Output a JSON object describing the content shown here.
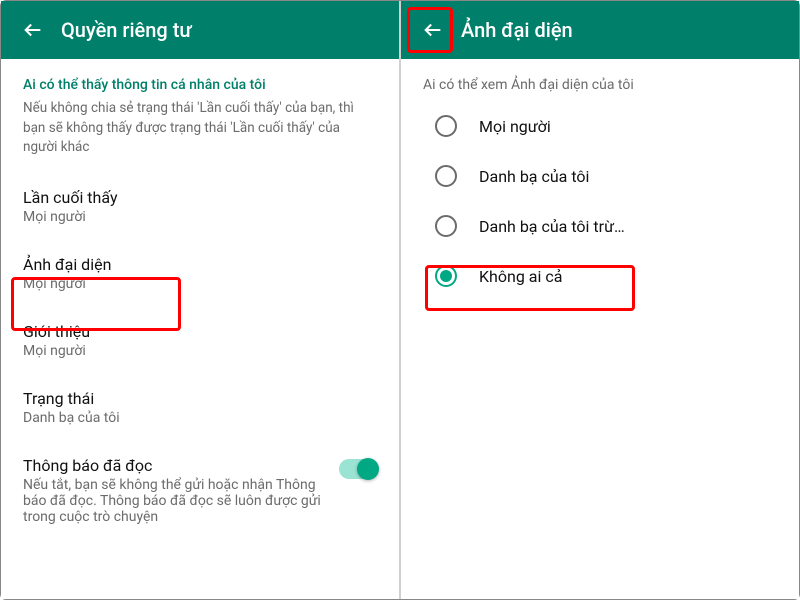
{
  "left": {
    "title": "Quyền riêng tư",
    "section_label": "Ai có thể thấy thông tin cá nhân của tôi",
    "section_note": "Nếu không chia sẻ trạng thái 'Lần cuối thấy' của bạn, thì bạn sẽ không thấy được trạng thái 'Lần cuối thấy' của người khác",
    "items": [
      {
        "title": "Lần cuối thấy",
        "sub": "Mọi người"
      },
      {
        "title": "Ảnh đại diện",
        "sub": "Mọi người"
      },
      {
        "title": "Giới thiệu",
        "sub": "Mọi người"
      },
      {
        "title": "Trạng thái",
        "sub": "Danh bạ của tôi"
      }
    ],
    "read_receipts": {
      "title": "Thông báo đã đọc",
      "note": "Nếu tắt, bạn sẽ không thể gửi hoặc nhận Thông báo đã đọc. Thông báo đã đọc sẽ luôn được gửi trong cuộc trò chuyện"
    }
  },
  "right": {
    "title": "Ảnh đại diện",
    "radio_label": "Ai có thể xem Ảnh đại diện của tôi",
    "options": [
      {
        "label": "Mọi người"
      },
      {
        "label": "Danh bạ của tôi"
      },
      {
        "label": "Danh bạ của tôi trừ…"
      },
      {
        "label": "Không ai cả"
      }
    ],
    "selected_index": 3
  }
}
